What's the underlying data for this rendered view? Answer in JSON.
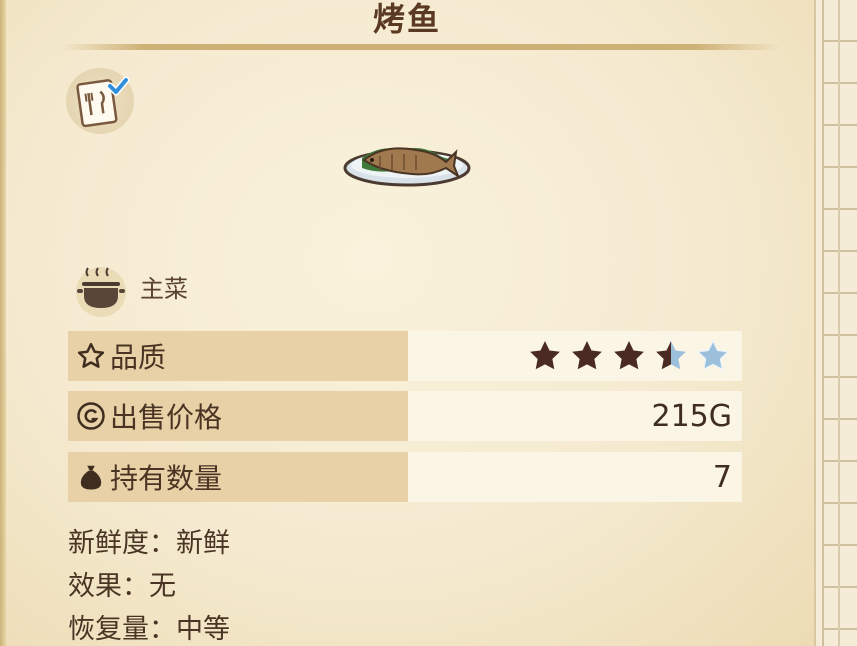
{
  "title": "烤鱼",
  "category": {
    "label": "主菜",
    "icon": "cooking-pot-icon"
  },
  "stats": [
    {
      "label": "品质",
      "icon": "star-outline-icon",
      "value": "",
      "rating": 3.5,
      "max": 5
    },
    {
      "label": "出售价格",
      "icon": "coin-g-icon",
      "value": "215G"
    },
    {
      "label": "持有数量",
      "icon": "money-bag-icon",
      "value": "7"
    }
  ],
  "details": {
    "freshness": "新鲜度：新鲜",
    "effect": "效果：无",
    "recovery": "恢复量：中等"
  },
  "colors": {
    "paper": "#f5ead0",
    "label_bg": "#e8d1a6",
    "value_bg": "#fbf5e6",
    "star_filled": "#4a2a22",
    "star_empty": "#9cc0dc"
  }
}
